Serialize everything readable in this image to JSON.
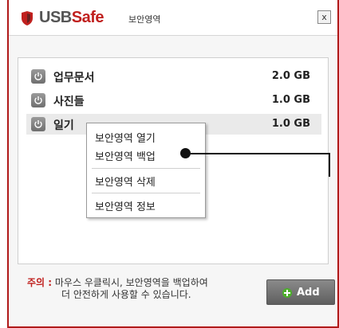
{
  "titlebar": {
    "brand_usb": "USB",
    "brand_safe": "Safe",
    "subtitle": "보안영역",
    "close": "x"
  },
  "list": {
    "items": [
      {
        "name": "업무문서",
        "size": "2.0 GB",
        "selected": false
      },
      {
        "name": "사진들",
        "size": "1.0 GB",
        "selected": false
      },
      {
        "name": "일기",
        "size": "1.0 GB",
        "selected": true
      }
    ]
  },
  "context_menu": {
    "items": [
      "보안영역 열기",
      "보안영역 백업",
      "보안영역 삭제",
      "보안영역 정보"
    ]
  },
  "note": {
    "label": "주의 :",
    "line1": "마우스 우클릭시, 보안영역을 백업하여",
    "line2": "더 안전하게 사용할 수 있습니다."
  },
  "add_button": {
    "label": "Add"
  },
  "colors": {
    "brand_red": "#c0201e",
    "brand_gray": "#555555",
    "add_icon_green": "#4caf2a"
  }
}
